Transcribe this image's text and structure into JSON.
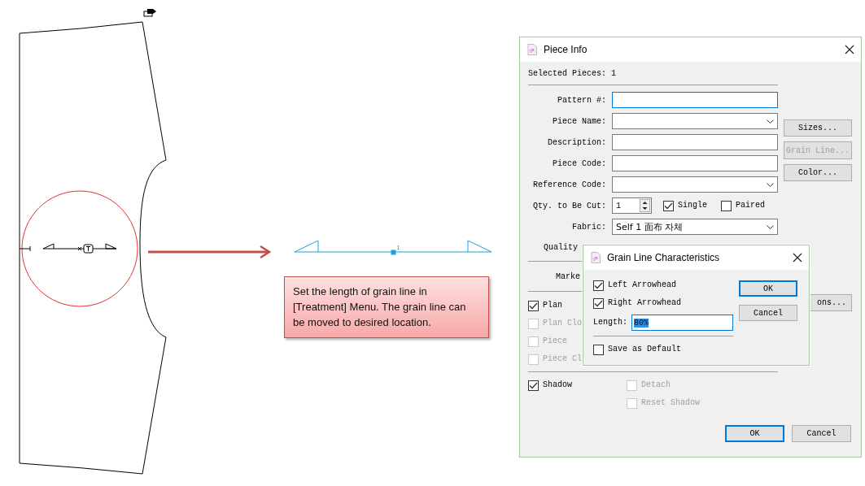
{
  "canvas": {
    "grain_label": "1",
    "note": "Set the length of grain line in [Treatment] Menu.  The grain line can be moved to desired location."
  },
  "piece_info": {
    "title": "Piece Info",
    "selected_pieces": "Selected Pieces: 1",
    "fields": [
      {
        "label": "Pattern #:",
        "kind": "text",
        "focused": true
      },
      {
        "label": "Piece Name:",
        "kind": "combo",
        "focused": false
      },
      {
        "label": "Description:",
        "kind": "text",
        "focused": false
      },
      {
        "label": "Piece Code:",
        "kind": "text",
        "focused": false
      },
      {
        "label": "Reference Code:",
        "kind": "combo",
        "focused": false
      }
    ],
    "qty": {
      "label": "Qty. to Be Cut:",
      "value": "1"
    },
    "cut_options": [
      {
        "label": "Single",
        "checked": true
      },
      {
        "label": "Paired",
        "checked": false
      }
    ],
    "fabric": {
      "label": "Fabric:",
      "value": "Self 1 面布 자체"
    },
    "quality_label": "Quality",
    "marker_label": "Marke",
    "side_buttons": [
      {
        "label": "Sizes...",
        "disabled": false
      },
      {
        "label": "Grain Line...",
        "disabled": true
      },
      {
        "label": "Color...",
        "disabled": false
      }
    ],
    "options_button": "ons...",
    "plan_checks": [
      {
        "label": "Plan",
        "checked": true,
        "disabled": false
      },
      {
        "label": "Plan Clo",
        "checked": false,
        "disabled": true
      },
      {
        "label": "Piece",
        "checked": false,
        "disabled": true
      },
      {
        "label": "Piece Cl",
        "checked": false,
        "disabled": true
      }
    ],
    "shadow": {
      "label": "Shadow",
      "checked": true,
      "disabled": false
    },
    "shadow_options": [
      {
        "label": "Detach",
        "checked": false,
        "disabled": true
      },
      {
        "label": "Reset Shadow",
        "checked": false,
        "disabled": true
      }
    ],
    "buttons": [
      {
        "label": "OK",
        "default": true
      },
      {
        "label": "Cancel",
        "default": false
      }
    ]
  },
  "grain_line_dialog": {
    "title": "Grain Line Characteristics",
    "checks": [
      {
        "label": "Left Arrowhead",
        "checked": true
      },
      {
        "label": "Right Arrowhead",
        "checked": true
      }
    ],
    "length": {
      "label": "Length:",
      "value": "80%",
      "selected": true
    },
    "save_default": {
      "label": "Save as Default",
      "checked": false
    },
    "buttons": [
      {
        "label": "OK",
        "default": true
      },
      {
        "label": "Cancel",
        "default": false
      }
    ]
  }
}
